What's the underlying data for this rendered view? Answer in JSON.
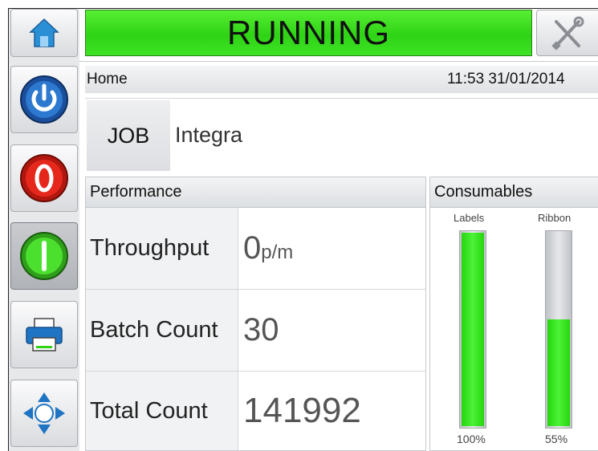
{
  "status": {
    "label": "RUNNING",
    "color": "#2fd315"
  },
  "header": {
    "breadcrumb": "Home",
    "datetime": "11:53 31/01/2014"
  },
  "job": {
    "label": "JOB",
    "name": "Integra"
  },
  "sidebar": {
    "items": [
      {
        "icon": "home-icon"
      },
      {
        "icon": "power-icon"
      },
      {
        "icon": "stop-icon"
      },
      {
        "icon": "start-icon"
      },
      {
        "icon": "printer-icon"
      },
      {
        "icon": "navigate-icon"
      }
    ]
  },
  "tools": {
    "icon": "tools-icon"
  },
  "performance": {
    "title": "Performance",
    "rows": [
      {
        "label": "Throughput",
        "value": "0",
        "unit": "p/m"
      },
      {
        "label": "Batch Count",
        "value": "30",
        "unit": ""
      },
      {
        "label": "Total Count",
        "value": "141992",
        "unit": ""
      }
    ]
  },
  "consumables": {
    "title": "Consumables",
    "items": [
      {
        "label": "Labels",
        "percent_text": "100%",
        "level": 1.0
      },
      {
        "label": "Ribbon",
        "percent_text": "55%",
        "level": 0.55
      }
    ]
  }
}
